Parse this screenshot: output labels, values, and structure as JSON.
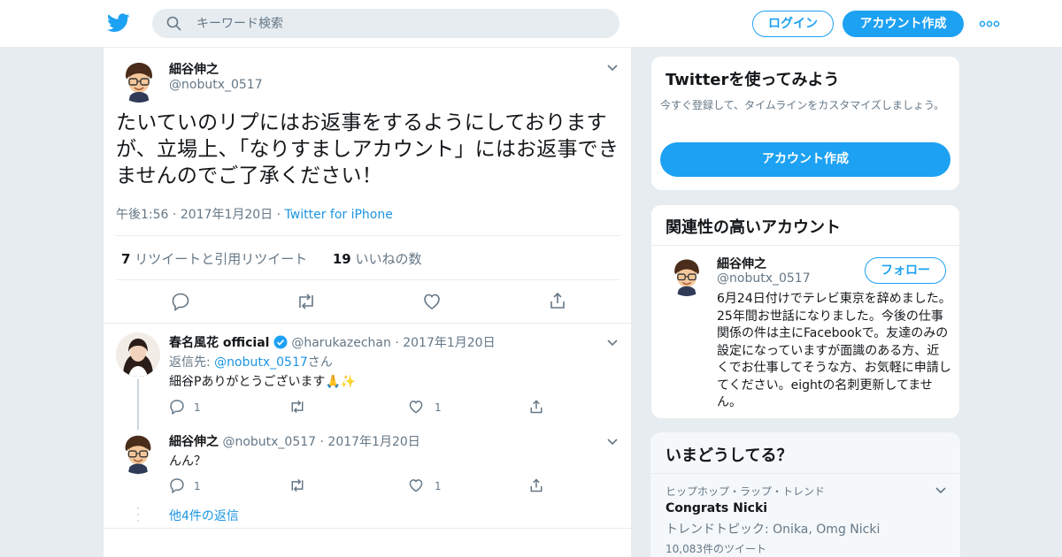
{
  "header": {
    "search_placeholder": "キーワード検索",
    "login_label": "ログイン",
    "signup_label": "アカウント作成"
  },
  "tweet": {
    "author_name": "細谷伸之",
    "author_handle": "@nobutx_0517",
    "text": "たいていのリプにはお返事をするようにしておりますが、立場上、「なりすましアカウント」にはお返事できませんのでご了承ください！",
    "time": "午後1:56",
    "date": "2017年1月20日",
    "source": "Twitter for iPhone",
    "retweet_count": "7",
    "retweet_label": "リツイートと引用リツイート",
    "like_count": "19",
    "like_label": "いいねの数"
  },
  "replies": [
    {
      "author_name": "春名風花 official",
      "author_handle": "@harukazechan",
      "date": "2017年1月20日",
      "reply_to_prefix": "返信先: ",
      "reply_to_handle": "@nobutx_0517",
      "reply_to_suffix": "さん",
      "text": "細谷Pありがとうございます🙏✨",
      "reply_count": "1",
      "like_count": "1"
    },
    {
      "author_name": "細谷伸之",
      "author_handle": "@nobutx_0517",
      "date": "2017年1月20日",
      "text": "んん？",
      "reply_count": "1",
      "like_count": "1"
    }
  ],
  "more_replies_label": "他4件の返信",
  "sidebar": {
    "try": {
      "title": "Twitterを使ってみよう",
      "desc": "今すぐ登録して、タイムラインをカスタマイズしましょう。",
      "button": "アカウント作成"
    },
    "related": {
      "title": "関連性の高いアカウント",
      "name": "細谷伸之",
      "handle": "@nobutx_0517",
      "follow_label": "フォロー",
      "bio": "6月24日付けでテレビ東京を辞めました。 25年間お世話になりました。今後の仕事関係の件は主にFacebookで。友達のみの設定になっていますが面識のある方、近くでお仕事してそうな方、お気軽に申請してください。eightの名刺更新してません。"
    },
    "trends": {
      "title": "いまどうしてる？",
      "context": "ヒップホップ・ラップ・トレンド",
      "name": "Congrats Nicki",
      "sub": "トレンドトピック: Onika, Omg Nicki",
      "count": "10,083件のツイート"
    }
  },
  "colors": {
    "brand_blue": "#1da1f2",
    "link_blue": "#1b95e0",
    "secondary_text": "#657786",
    "page_bg": "#e6ecf0"
  }
}
